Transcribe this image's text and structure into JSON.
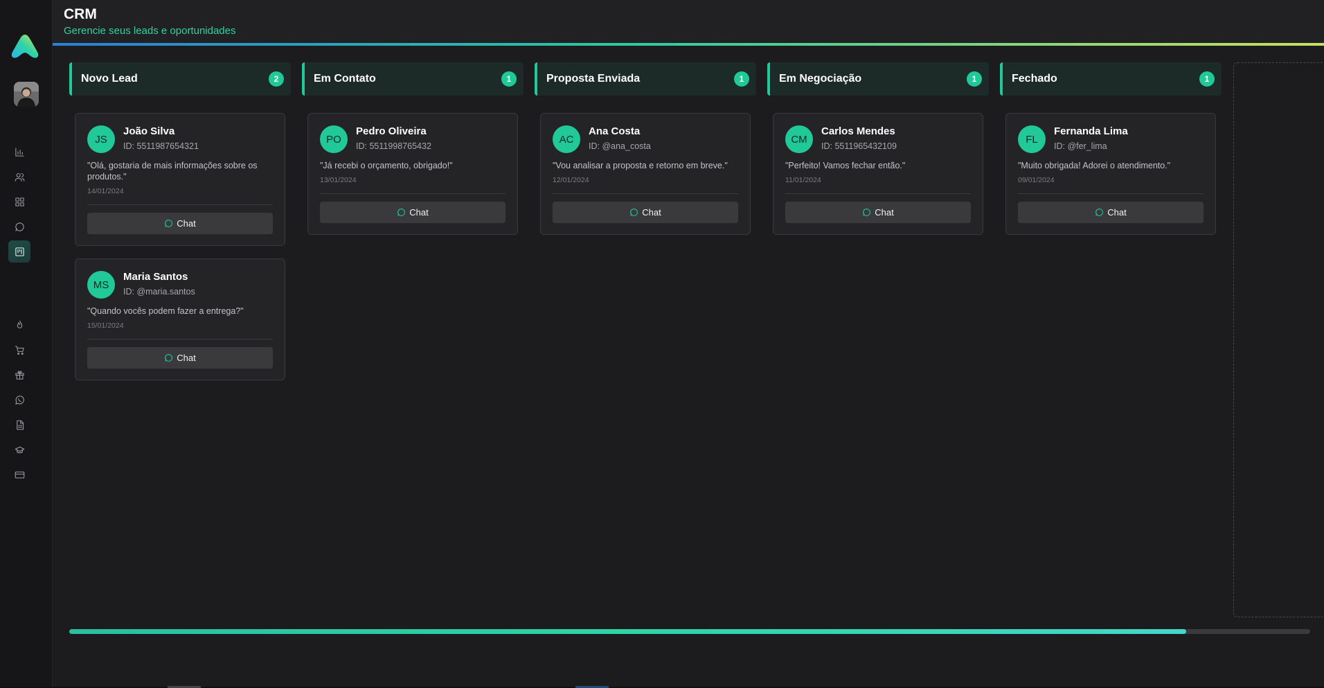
{
  "header": {
    "title": "CRM",
    "subtitle": "Gerencie seus leads e oportunidades"
  },
  "sidebar": {
    "logo_icon": "brand-logo-icon",
    "nav_top": [
      "bar-chart-icon",
      "users-icon",
      "grid-icon",
      "message-circle-icon",
      "kanban-icon"
    ],
    "nav_bottom": [
      "flame-icon",
      "cart-icon",
      "gift-icon",
      "whatsapp-icon",
      "document-icon",
      "graduation-cap-icon",
      "credit-card-icon"
    ],
    "active": "kanban-icon"
  },
  "board": {
    "columns": [
      {
        "title": "Novo Lead",
        "count": "2",
        "cards": [
          {
            "initials": "JS",
            "name": "João Silva",
            "id": "ID: 5511987654321",
            "message": "\"Olá, gostaria de mais informações sobre os produtos.\"",
            "date": "14/01/2024",
            "button": "Chat"
          },
          {
            "initials": "MS",
            "name": "Maria Santos",
            "id": "ID: @maria.santos",
            "message": "\"Quando vocês podem fazer a entrega?\"",
            "date": "15/01/2024",
            "button": "Chat"
          }
        ]
      },
      {
        "title": "Em Contato",
        "count": "1",
        "cards": [
          {
            "initials": "PO",
            "name": "Pedro Oliveira",
            "id": "ID: 5511998765432",
            "message": "\"Já recebi o orçamento, obrigado!\"",
            "date": "13/01/2024",
            "button": "Chat"
          }
        ]
      },
      {
        "title": "Proposta Enviada",
        "count": "1",
        "cards": [
          {
            "initials": "AC",
            "name": "Ana Costa",
            "id": "ID: @ana_costa",
            "message": "\"Vou analisar a proposta e retorno em breve.\"",
            "date": "12/01/2024",
            "button": "Chat"
          }
        ]
      },
      {
        "title": "Em Negociação",
        "count": "1",
        "cards": [
          {
            "initials": "CM",
            "name": "Carlos Mendes",
            "id": "ID: 5511965432109",
            "message": "\"Perfeito! Vamos fechar então.\"",
            "date": "11/01/2024",
            "button": "Chat"
          }
        ]
      },
      {
        "title": "Fechado",
        "count": "1",
        "cards": [
          {
            "initials": "FL",
            "name": "Fernanda Lima",
            "id": "ID: @fer_lima",
            "message": "\"Muito obrigada! Adorei o atendimento.\"",
            "date": "09/01/2024",
            "button": "Chat"
          }
        ]
      }
    ]
  },
  "scroll": {
    "position_fraction": 0.9
  },
  "colors": {
    "accent": "#20c997",
    "header_subtitle": "#2ed3a0",
    "background": "#1c1c1e"
  }
}
